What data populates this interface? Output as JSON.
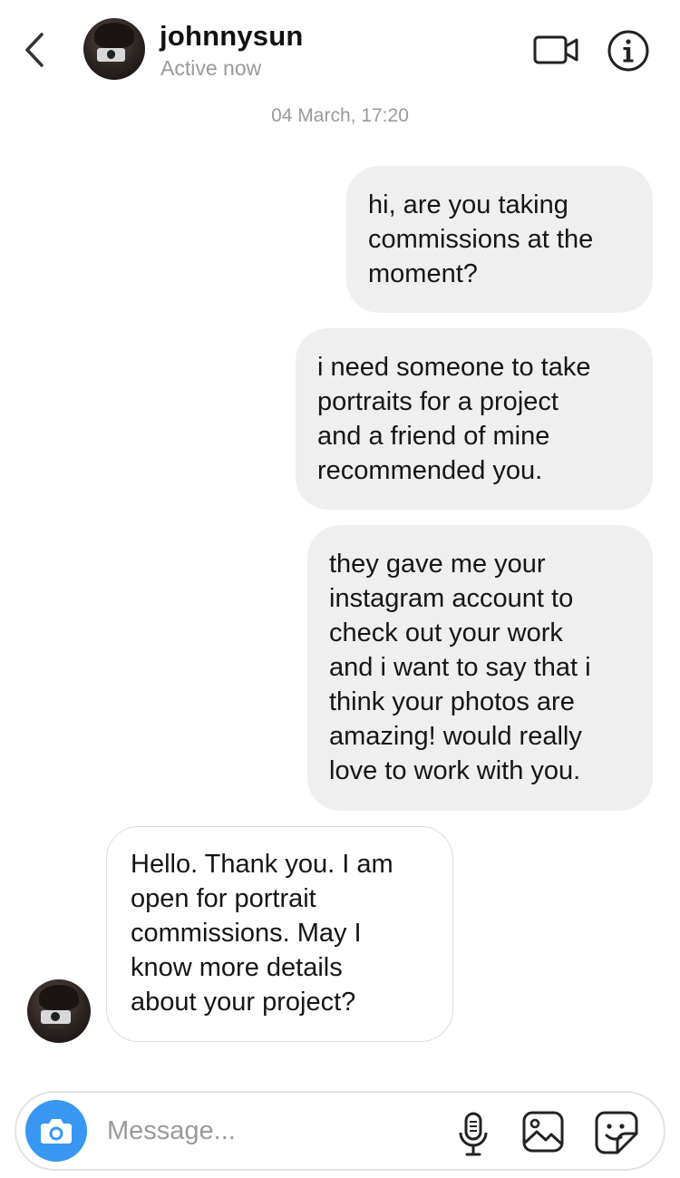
{
  "header": {
    "username": "johnnysun",
    "status": "Active now",
    "icons": {
      "back": "chevron-left-icon",
      "video": "video-camera-icon",
      "info": "info-icon"
    }
  },
  "thread": {
    "timestamp": "04 March, 17:20",
    "messages": [
      {
        "direction": "outgoing",
        "text": "hi, are you taking\ncommissions at the\nmoment?"
      },
      {
        "direction": "outgoing",
        "text": "i need someone to take\nportraits for a project\nand a friend of mine\nrecommended you."
      },
      {
        "direction": "outgoing",
        "text": "they gave me your\ninstagram account to\ncheck out your work\nand i want to say that i\nthink your photos are\namazing! would really\nlove to work with you."
      },
      {
        "direction": "incoming",
        "text": "Hello. Thank you. I am\nopen for portrait\ncommissions. May I\nknow more details\nabout your project?"
      }
    ]
  },
  "composer": {
    "placeholder": "Message...",
    "value": "",
    "icons": [
      "camera-icon",
      "microphone-icon",
      "gallery-icon",
      "sticker-icon"
    ]
  },
  "colors": {
    "accent": "#3897f0",
    "outgoing_bubble": "#efefef",
    "incoming_border": "#dcdcdc",
    "muted_text": "#9a9a9a"
  }
}
